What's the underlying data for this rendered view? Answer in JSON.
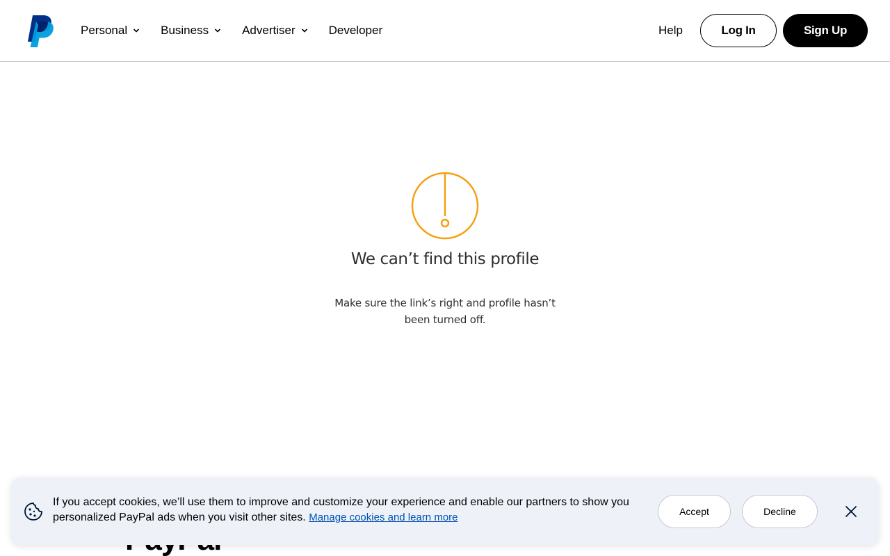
{
  "header": {
    "nav": [
      {
        "label": "Personal",
        "has_dropdown": true
      },
      {
        "label": "Business",
        "has_dropdown": true
      },
      {
        "label": "Advertiser",
        "has_dropdown": true
      },
      {
        "label": "Developer",
        "has_dropdown": false
      }
    ],
    "help_label": "Help",
    "login_label": "Log In",
    "signup_label": "Sign Up"
  },
  "main": {
    "icon": "alert-exclamation-icon",
    "title": "We can’t find this profile",
    "subtitle": "Make sure the link’s right and profile hasn’t been turned off."
  },
  "footer": {
    "wordmark": "PayPal"
  },
  "cookie_banner": {
    "text": "If you accept cookies, we’ll use them to improve and customize your experience and enable our partners to show you personalized PayPal ads when you visit other sites.",
    "link_label": "Manage cookies and learn more",
    "accept_label": "Accept",
    "decline_label": "Decline"
  },
  "colors": {
    "brand_dark_blue": "#003087",
    "brand_light_blue": "#009cde",
    "alert_orange": "#f59e0b",
    "link_blue": "#0051b3",
    "banner_bg": "#eef2f8"
  }
}
